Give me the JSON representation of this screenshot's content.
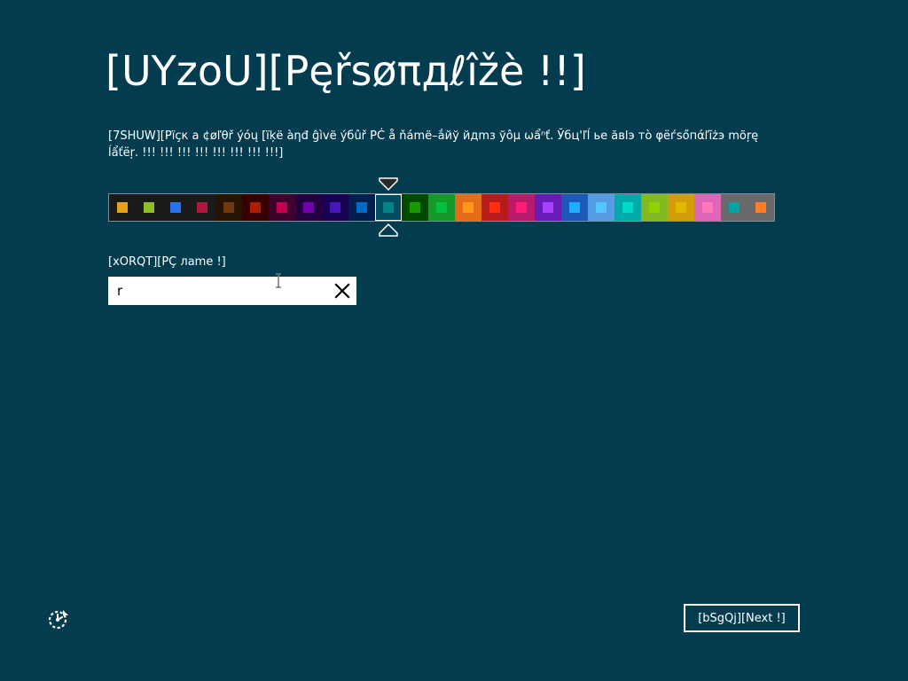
{
  "page": {
    "title": "[UYzoU][Pęřsøπдℓîžè !!]",
    "description": "[7SHUW][Pïçк a ¢øľθř ýóų [ïķë àηđ ĝìvë ýбûř PĊ å ňámë–ắйў йдmз ўôμ ωẩⁿť. Ўбц'ľĺ ье ăвlэ тò φёѓѕőпάľĭżэ mõŗę ĺẩťёŗ. !!! !!! !!! !!! !!! !!! !!! !!!]",
    "pc_name_label": "[xORQT][PÇ лame !]",
    "pc_name_value": "r",
    "next_label": "[bSgQj][Next !]"
  },
  "accent": {
    "background": "#033c4f",
    "selected_index": 10
  },
  "colors": [
    {
      "bg": "#1a1a1a",
      "chip": "#e3a21a"
    },
    {
      "bg": "#1a1a1a",
      "chip": "#8cbf26"
    },
    {
      "bg": "#1a1a1a",
      "chip": "#2672ec"
    },
    {
      "bg": "#1a1a1a",
      "chip": "#ac193d"
    },
    {
      "bg": "#261300",
      "chip": "#6e3a0e"
    },
    {
      "bg": "#380000",
      "chip": "#b01e00"
    },
    {
      "bg": "#40002e",
      "chip": "#c1004f"
    },
    {
      "bg": "#250040",
      "chip": "#7200ac"
    },
    {
      "bg": "#180052",
      "chip": "#4617b4"
    },
    {
      "bg": "#001e4e",
      "chip": "#006ac1"
    },
    {
      "bg": "#004d60",
      "chip": "#008287"
    },
    {
      "bg": "#004a00",
      "chip": "#199900"
    },
    {
      "bg": "#15992a",
      "chip": "#00c13f"
    },
    {
      "bg": "#e56c19",
      "chip": "#ff981d"
    },
    {
      "bg": "#b81b1b",
      "chip": "#ff2e12"
    },
    {
      "bg": "#b81b6c",
      "chip": "#ff1d77"
    },
    {
      "bg": "#691bb8",
      "chip": "#aa40ff"
    },
    {
      "bg": "#1b58b8",
      "chip": "#1faeff"
    },
    {
      "bg": "#569ce3",
      "chip": "#56c5ff"
    },
    {
      "bg": "#00aaaa",
      "chip": "#00d8cc"
    },
    {
      "bg": "#83ba1f",
      "chip": "#91d100"
    },
    {
      "bg": "#d39d09",
      "chip": "#e1b700"
    },
    {
      "bg": "#e064b7",
      "chip": "#ff76bc"
    },
    {
      "bg": "#696969",
      "chip": "#00a4a4"
    },
    {
      "bg": "#696969",
      "chip": "#ff7d23"
    }
  ],
  "icons": {
    "clear": "close-icon",
    "ease_of_access": "ease-of-access-icon",
    "cursor": "text-cursor-icon"
  }
}
